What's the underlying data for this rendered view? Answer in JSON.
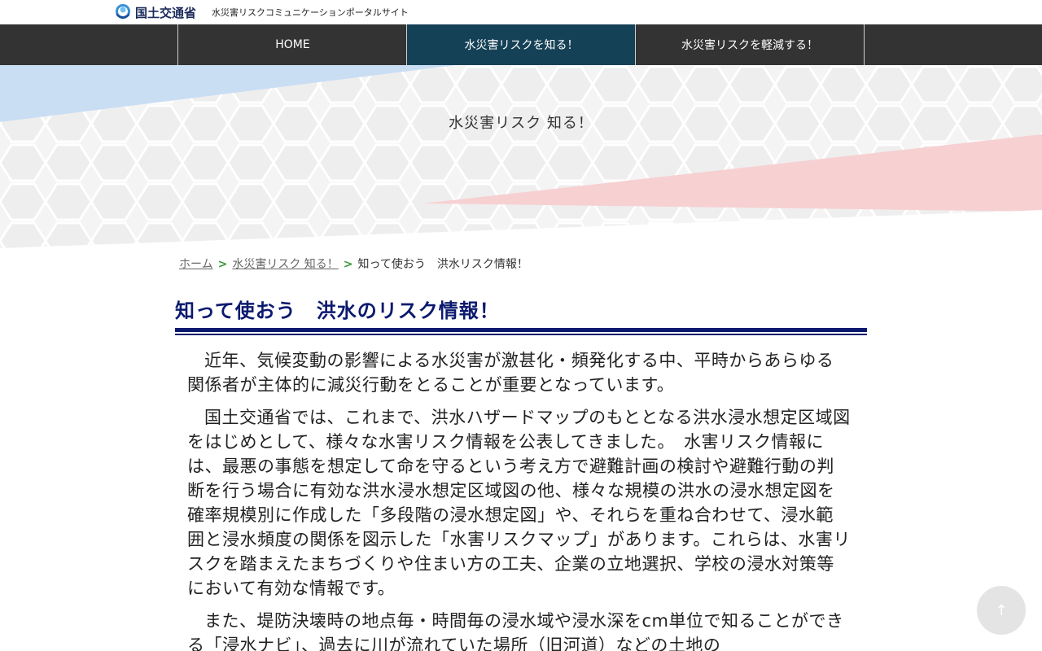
{
  "header": {
    "logo_text": "国土交通省",
    "site_title": "水災害リスクコミュニケーションポータルサイト"
  },
  "nav": {
    "items": [
      {
        "label": "HOME"
      },
      {
        "label": "水災害リスクを知る！"
      },
      {
        "label": "水災害リスクを軽減する！"
      }
    ],
    "active_index": 1
  },
  "hero": {
    "title": "水災害リスク 知る！"
  },
  "breadcrumb": {
    "items": [
      {
        "label": "ホーム"
      },
      {
        "label": "水災害リスク 知る！"
      },
      {
        "label": "知って使おう　洪水リスク情報！"
      }
    ],
    "separator": ">"
  },
  "page": {
    "heading": "知って使おう　洪水のリスク情報！",
    "paragraphs": [
      "近年、気候変動の影響による水災害が激甚化・頻発化する中、平時からあらゆる関係者が主体的に減災行動をとることが重要となっています。",
      "国土交通省では、これまで、洪水ハザードマップのもととなる洪水浸水想定区域図をはじめとして、様々な水害リスク情報を公表してきました。　水害リスク情報には、最悪の事態を想定して命を守るという考え方で避難計画の検討や避難行動の判断を行う場合に有効な洪水浸水想定区域図の他、様々な規模の洪水の浸水想定図を確率規模別に作成した「多段階の浸水想定図」や、それらを重ね合わせて、浸水範囲と浸水頻度の関係を図示した「水害リスクマップ」があります。これらは、水害リスクを踏まえたまちづくりや住まい方の工夫、企業の立地選択、学校の浸水対策等において有効な情報です。",
      "また、堤防決壊時の地点毎・時間毎の浸水域や浸水深をcm単位で知ることができる「浸水ナビ」、過去に川が流れていた場所（旧河道）などの土地の"
    ]
  },
  "back_to_top": {
    "label": "↑"
  },
  "colors": {
    "nav_bg": "#333333",
    "nav_active": "#154157",
    "heading": "#0b1a6e",
    "breadcrumb_sep": "#3a9a3a"
  }
}
